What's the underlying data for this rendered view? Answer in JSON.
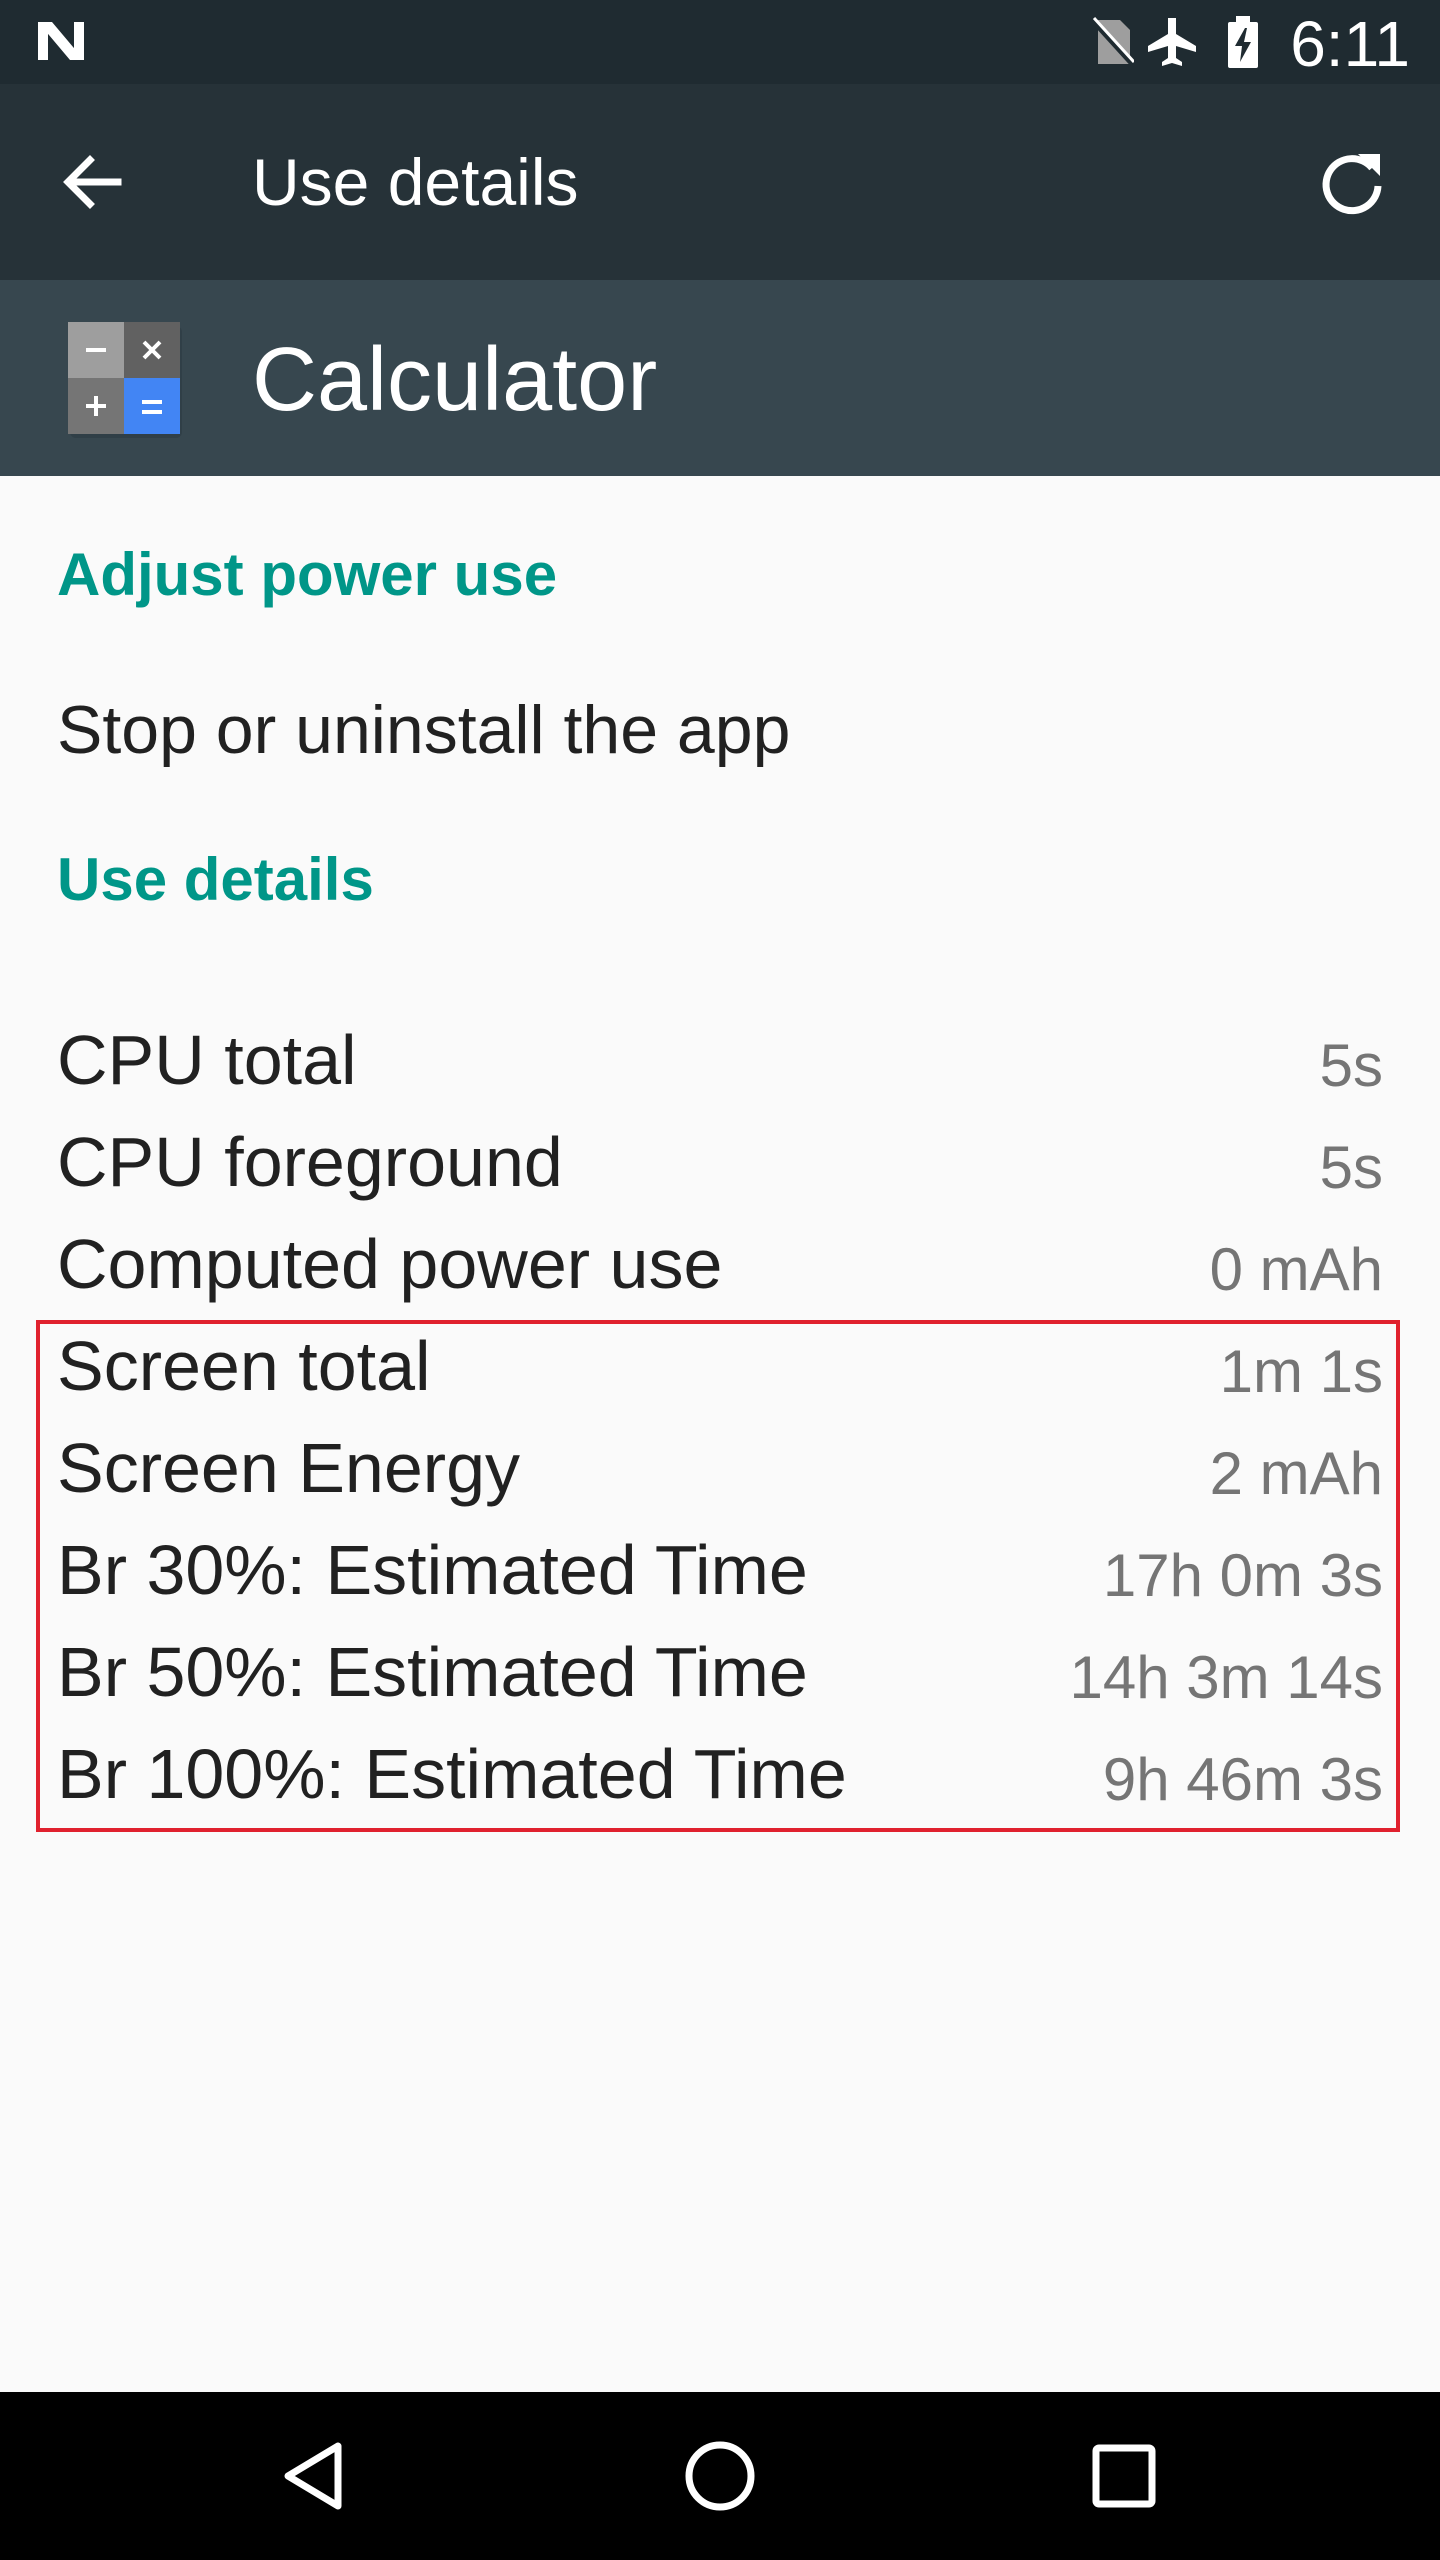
{
  "status_bar": {
    "time": "6:11",
    "icons": [
      "n-logo-icon",
      "no-sim-icon",
      "airplane-mode-icon",
      "battery-charging-icon"
    ]
  },
  "toolbar": {
    "title": "Use details",
    "back_icon": "back-arrow-icon",
    "refresh_icon": "refresh-icon"
  },
  "app_header": {
    "app_name": "Calculator",
    "icon": "calculator-icon"
  },
  "sections": {
    "adjust_power_use": "Adjust power use",
    "stop_or_uninstall": "Stop or uninstall the app",
    "use_details": "Use details"
  },
  "details": [
    {
      "label": "CPU total",
      "value": "5s"
    },
    {
      "label": "CPU foreground",
      "value": "5s"
    },
    {
      "label": "Computed power use",
      "value": "0 mAh"
    },
    {
      "label": "Screen total",
      "value": "1m 1s"
    },
    {
      "label": "Screen Energy",
      "value": "2 mAh"
    },
    {
      "label": "Br 30%: Estimated Time",
      "value": "17h 0m 3s"
    },
    {
      "label": "Br 50%: Estimated Time",
      "value": "14h 3m 14s"
    },
    {
      "label": "Br 100%: Estimated Time",
      "value": "9h 46m 3s"
    }
  ],
  "nav_bar": {
    "icons": [
      "back-triangle-icon",
      "home-circle-icon",
      "recents-square-icon"
    ]
  },
  "colors": {
    "status_bar": "#1f2b31",
    "toolbar": "#263238",
    "app_header": "#37474f",
    "accent": "#009688",
    "highlight": "#e0212e"
  }
}
